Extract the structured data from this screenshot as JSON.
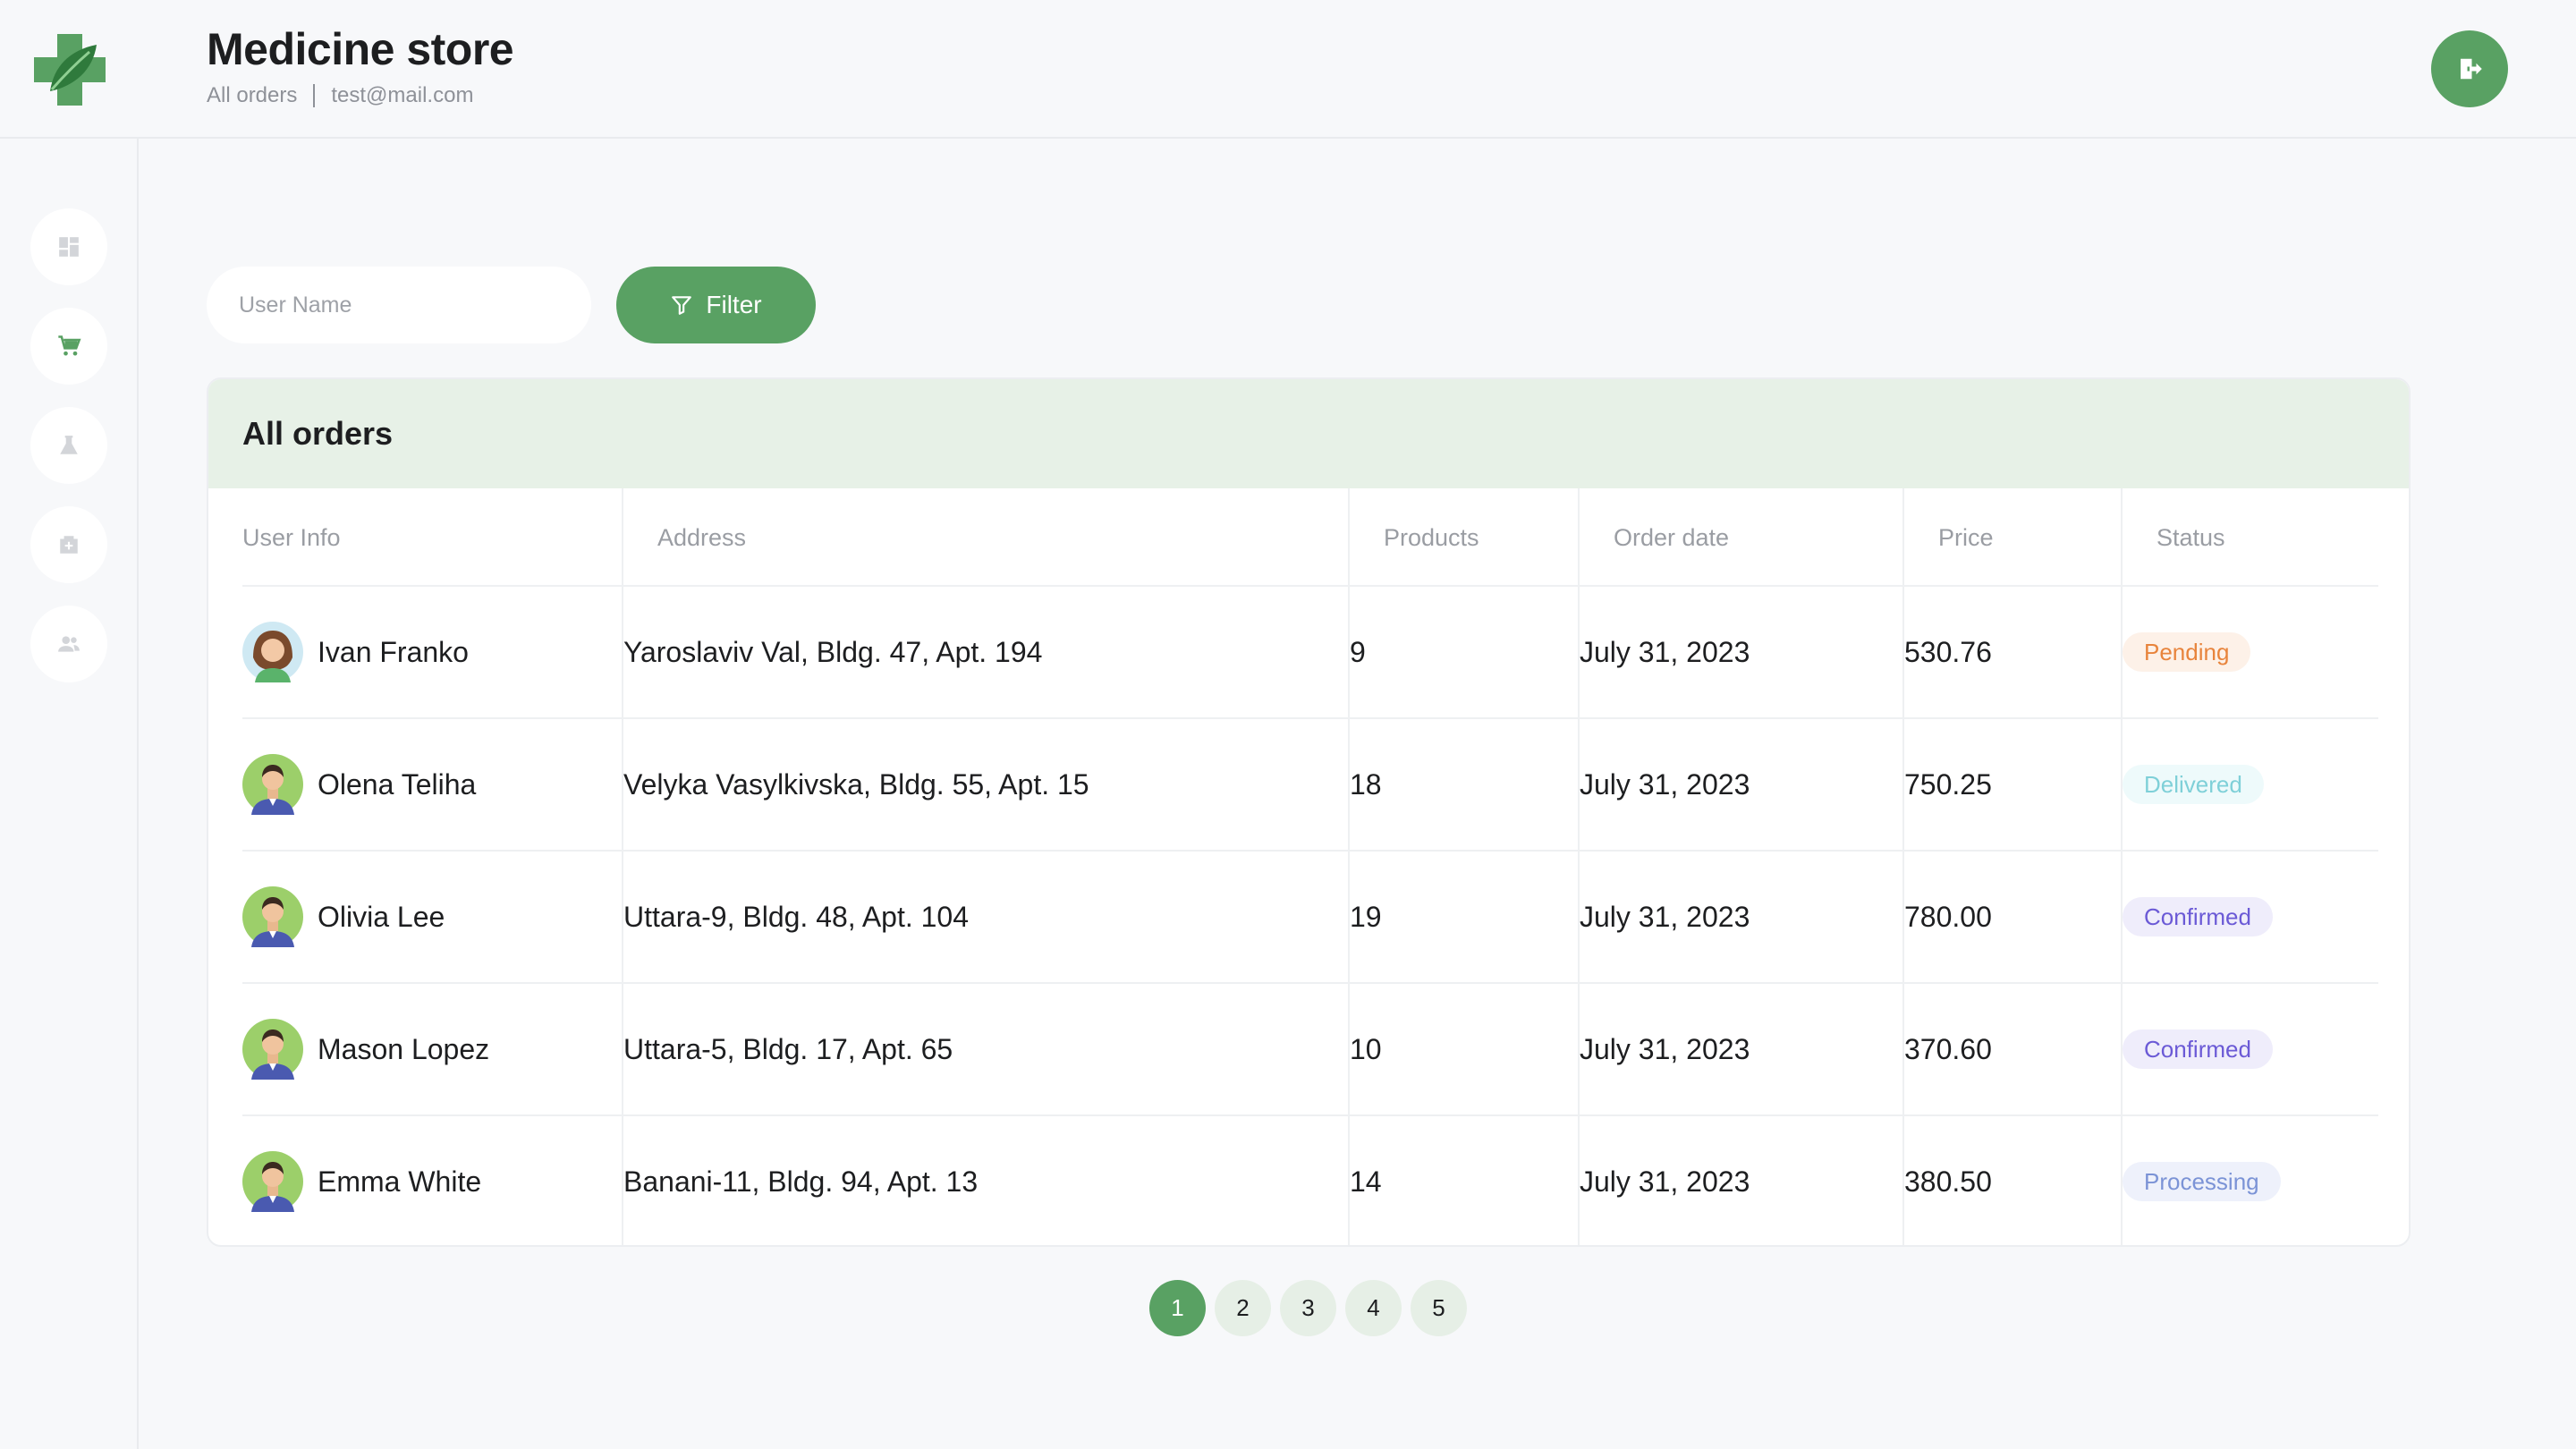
{
  "header": {
    "title": "Medicine store",
    "breadcrumb": "All orders",
    "email": "test@mail.com",
    "logout_icon": "logout-icon"
  },
  "sidebar": {
    "items": [
      {
        "icon": "dashboard-icon"
      },
      {
        "icon": "cart-icon",
        "active": true
      },
      {
        "icon": "flask-icon"
      },
      {
        "icon": "pharmacy-icon"
      },
      {
        "icon": "users-icon"
      }
    ]
  },
  "filter": {
    "placeholder": "User Name",
    "button_label": "Filter",
    "icon": "filter-icon"
  },
  "orders": {
    "title": "All orders",
    "columns": [
      "User Info",
      "Address",
      "Products",
      "Order date",
      "Price",
      "Status"
    ],
    "rows": [
      {
        "name": "Ivan Franko",
        "address": "Yaroslaviv Val, Bldg. 47, Apt. 194",
        "products": "9",
        "date": "July 31, 2023",
        "price": "530.76",
        "status": "Pending"
      },
      {
        "name": "Olena Teliha",
        "address": "Velyka Vasylkivska, Bldg. 55, Apt. 15",
        "products": "18",
        "date": "July 31, 2023",
        "price": "750.25",
        "status": "Delivered"
      },
      {
        "name": "Olivia Lee",
        "address": "Uttara-9, Bldg. 48, Apt. 104",
        "products": "19",
        "date": "July 31, 2023",
        "price": "780.00",
        "status": "Confirmed"
      },
      {
        "name": "Mason Lopez",
        "address": "Uttara-5, Bldg. 17, Apt. 65",
        "products": "10",
        "date": "July 31, 2023",
        "price": "370.60",
        "status": "Confirmed"
      },
      {
        "name": "Emma White",
        "address": "Banani-11, Bldg. 94, Apt. 13",
        "products": "14",
        "date": "July 31, 2023",
        "price": "380.50",
        "status": "Processing"
      }
    ]
  },
  "pagination": {
    "pages": [
      "1",
      "2",
      "3",
      "4",
      "5"
    ],
    "current": "1"
  },
  "colors": {
    "accent": "#59a163",
    "status_pending": "#e8843c",
    "status_delivered": "#7fd0d8",
    "status_confirmed": "#6b5ad6",
    "status_processing": "#7b93d6"
  }
}
